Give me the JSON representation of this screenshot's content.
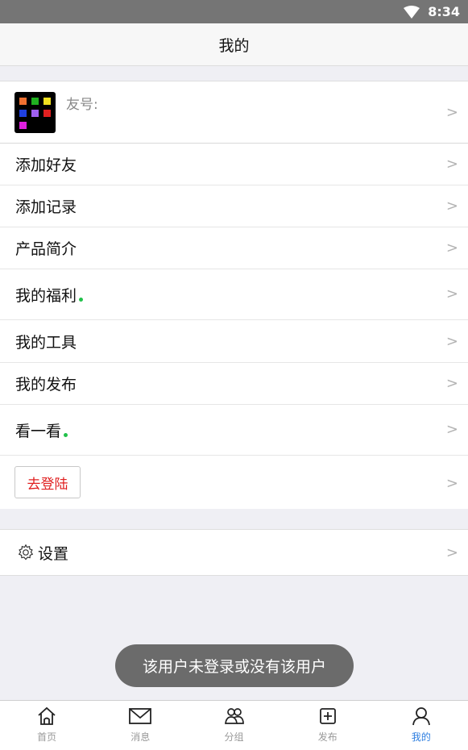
{
  "status": {
    "time": "8:34"
  },
  "header": {
    "title": "我的"
  },
  "profile": {
    "friend_label": "友号:"
  },
  "menu": [
    {
      "label": "添加好友",
      "dot": false
    },
    {
      "label": "添加记录",
      "dot": false
    },
    {
      "label": "产品简介",
      "dot": false
    },
    {
      "label": "我的福利",
      "dot": true
    },
    {
      "label": "我的工具",
      "dot": false
    },
    {
      "label": "我的发布",
      "dot": false
    },
    {
      "label": "看一看",
      "dot": true
    }
  ],
  "login": {
    "label": "去登陆"
  },
  "settings": {
    "label": "设置"
  },
  "toast": {
    "text": "该用户未登录或没有该用户"
  },
  "tabs": [
    {
      "label": "首页",
      "icon": "home-icon",
      "active": false
    },
    {
      "label": "消息",
      "icon": "mail-icon",
      "active": false
    },
    {
      "label": "分组",
      "icon": "group-icon",
      "active": false
    },
    {
      "label": "发布",
      "icon": "add-square-icon",
      "active": false
    },
    {
      "label": "我的",
      "icon": "person-icon",
      "active": true
    }
  ],
  "colors": {
    "accent": "#2f7fe0",
    "login_text": "#e02020",
    "dot": "#21c14a"
  },
  "chevron": ">"
}
